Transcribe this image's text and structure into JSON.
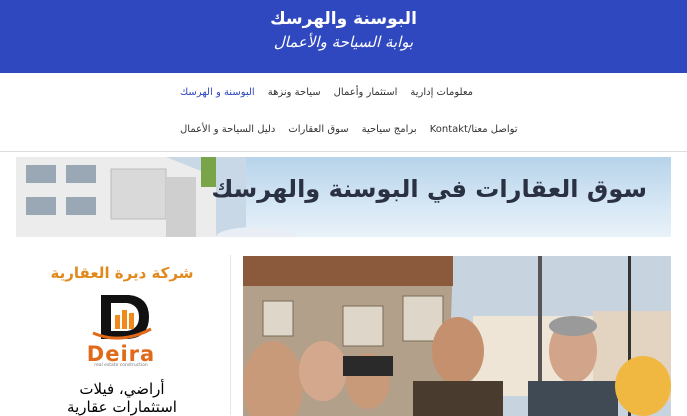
{
  "header": {
    "title": "البوسنة والهرسك",
    "tagline": "بوابة السياحة والأعمال"
  },
  "nav": {
    "row1": [
      {
        "label": "البوسنة و الهرسك",
        "active": true
      },
      {
        "label": "سياحة ونزهة"
      },
      {
        "label": "استثمار وأعمال"
      },
      {
        "label": "معلومات إدارية"
      }
    ],
    "row2": [
      {
        "label": "دليل السياحة و الأعمال"
      },
      {
        "label": "سوق العقارات"
      },
      {
        "label": "برامج سياحية"
      },
      {
        "label": "تواصل معنا/Kontakt"
      }
    ]
  },
  "banner": {
    "text": "سوق العقارات في البوسنة والهرسك"
  },
  "sidebar_ad": {
    "title": "شركة ديرة العقارية",
    "logo_name": "Deira",
    "logo_subtitle": "real estate construction",
    "line1": "أراضي، فيلات",
    "line2": "استثمارات عقارية"
  },
  "colors": {
    "header_bg": "#3048bf",
    "nav_active": "#3048bf",
    "ad_accent": "#e08a1e"
  }
}
